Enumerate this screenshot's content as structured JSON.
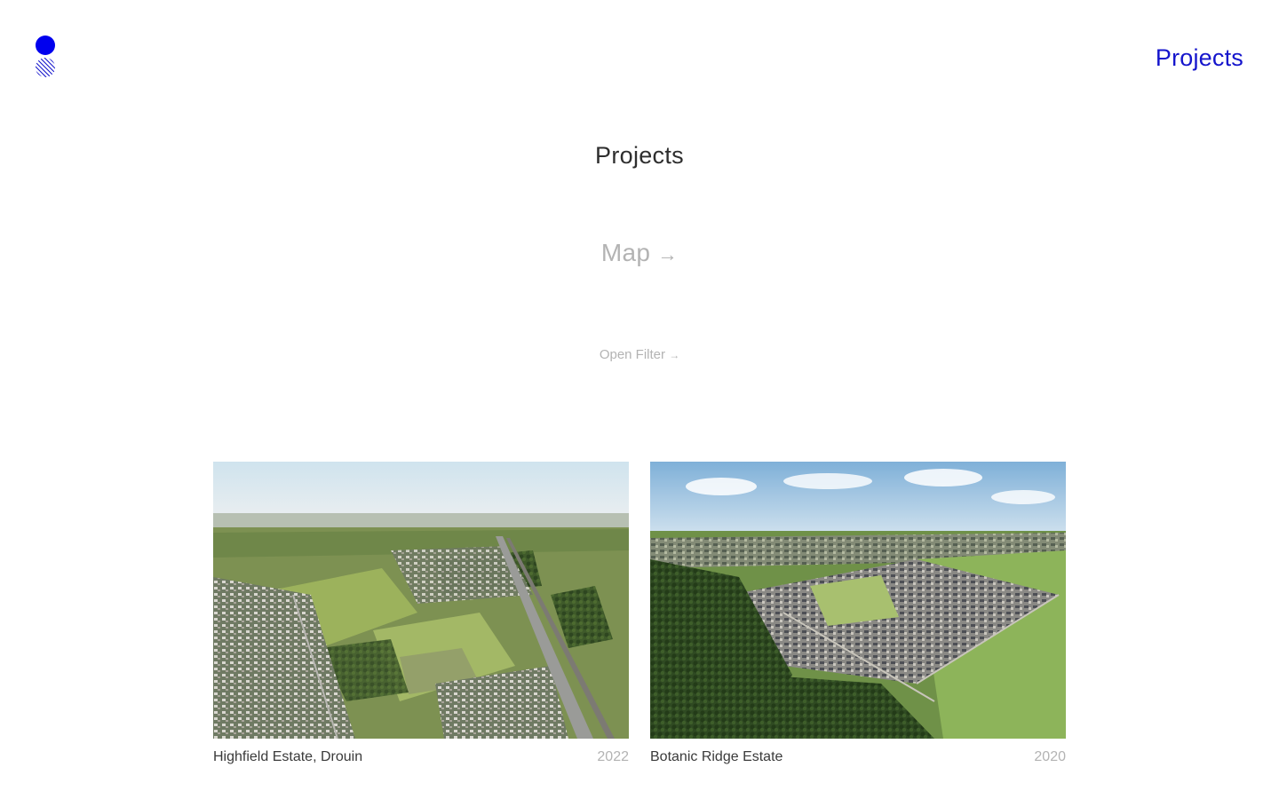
{
  "header": {
    "logo_icon": "brand-logo-icon",
    "nav_label": "Projects",
    "accent_color": "#1515cc"
  },
  "main": {
    "title": "Projects",
    "map_label": "Map",
    "map_arrow": "→",
    "filter_label": "Open Filter",
    "filter_arrow": "→"
  },
  "projects": [
    {
      "name": "Highfield Estate, Drouin",
      "year": "2022",
      "image_icon": "aerial-photo-highfield"
    },
    {
      "name": "Botanic Ridge Estate",
      "year": "2020",
      "image_icon": "aerial-photo-botanic-ridge"
    }
  ]
}
